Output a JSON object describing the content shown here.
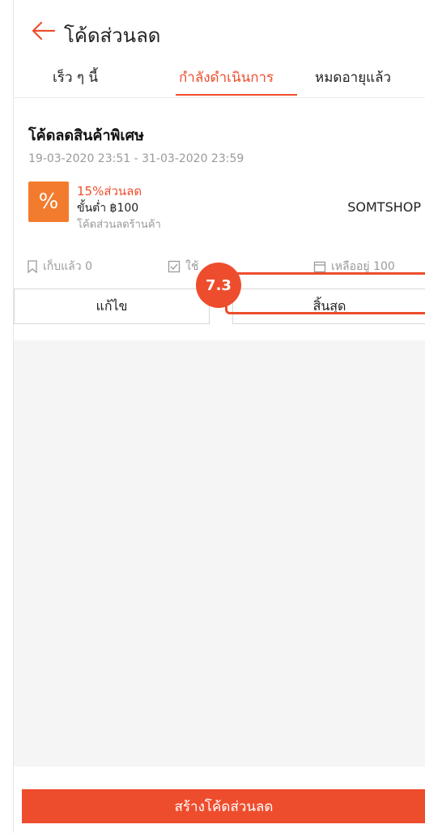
{
  "header": {
    "title": "โค้ดส่วนลด",
    "back_icon": "arrow-left-icon"
  },
  "tabs": [
    {
      "label": "เร็ว ๆ นี้"
    },
    {
      "label": "กำลังดำเนินการ"
    },
    {
      "label": "หมดอายุแล้ว"
    }
  ],
  "voucher": {
    "title": "โค้ดลดสินค้าพิเศษ",
    "period": "19-03-2020 23:51 - 31-03-2020 23:59",
    "icon_symbol": "%",
    "discount": "15%ส่วนลด",
    "minimum": "ขั้นต่ำ ฿100",
    "type": "โค้ดส่วนลดร้านค้า",
    "shop": "SOMTSHOP",
    "stats": {
      "collected": "เก็บแล้ว 0",
      "used": "ใช้",
      "remaining": "เหลืออยู่ 100"
    },
    "edit_label": "แก้ไข",
    "end_label": "สิ้นสุด"
  },
  "create_label": "สร้างโค้ดส่วนลด",
  "annotation": {
    "step": "7.3"
  },
  "colors": {
    "accent": "#ee4d2d",
    "badge": "#f37b2d",
    "muted": "#9a9a9a"
  }
}
